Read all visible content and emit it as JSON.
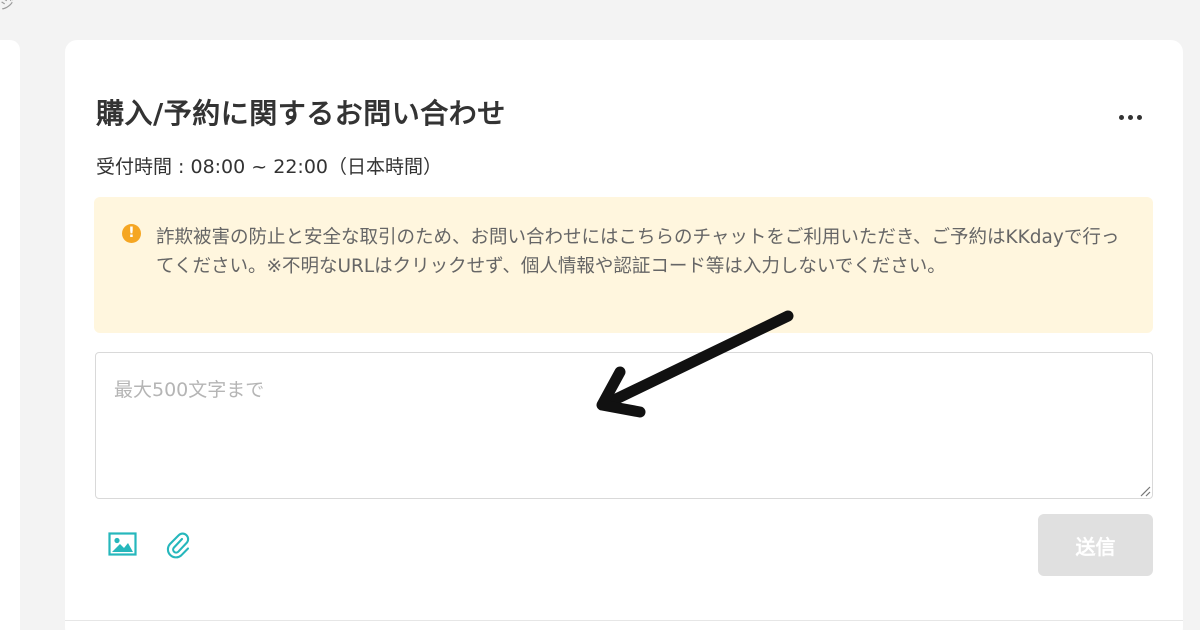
{
  "page": {
    "top_label": "ジ"
  },
  "chat": {
    "title": "購入/予約に関するお問い合わせ",
    "hours": "受付時間 : 08:00 ~ 22:00（日本時間）",
    "notice": {
      "icon": "warning-circle-icon",
      "icon_glyph": "!",
      "text": "詐欺被害の防止と安全な取引のため、お問い合わせにはこちらのチャットをご利用いただき、ご予約はKKdayで行ってください。※不明なURLはクリックせず、個人情報や認証コード等は入力しないでください。"
    },
    "input": {
      "value": "",
      "placeholder": "最大500文字まで"
    },
    "toolbar": {
      "image_icon": "image-icon",
      "attach_icon": "paperclip-icon"
    },
    "send_label": "送信"
  },
  "colors": {
    "accent_icon": "#26b7bc",
    "notice_bg": "#fff6de",
    "notice_icon": "#f5a623",
    "send_disabled_bg": "#e0e0e0"
  }
}
